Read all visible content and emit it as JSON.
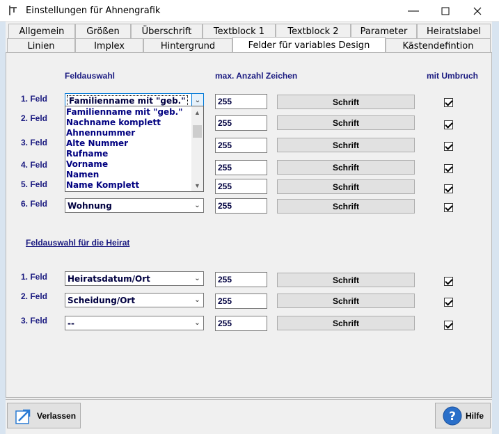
{
  "window": {
    "title": "Einstellungen für Ahnengrafik"
  },
  "tabs_row1": [
    "Allgemein",
    "Größen",
    "Überschrift",
    "Textblock 1",
    "Textblock 2",
    "Parameter",
    "Heiratslabel"
  ],
  "tabs_row2": [
    "Linien",
    "Implex",
    "Hintergrund",
    "Felder für variables Design",
    "Kästendefintion"
  ],
  "active_tab": "Felder für variables Design",
  "headers": {
    "feldauswahl": "Feldauswahl",
    "max_chars": "max. Anzahl Zeichen",
    "umbruch": "mit Umbruch"
  },
  "fields": [
    {
      "label": "1. Feld",
      "value": "Familienname mit \"geb.\"",
      "max": "255",
      "font": "Schrift",
      "wrap": true
    },
    {
      "label": "2. Feld",
      "value": "",
      "max": "255",
      "font": "Schrift",
      "wrap": true
    },
    {
      "label": "3. Feld",
      "value": "",
      "max": "255",
      "font": "Schrift",
      "wrap": true
    },
    {
      "label": "4. Feld",
      "value": "",
      "max": "255",
      "font": "Schrift",
      "wrap": true
    },
    {
      "label": "5. Feld",
      "value": "",
      "max": "255",
      "font": "Schrift",
      "wrap": true
    },
    {
      "label": "6. Feld",
      "value": "Wohnung",
      "max": "255",
      "font": "Schrift",
      "wrap": true
    }
  ],
  "dropdown_options": [
    "Familienname mit \"geb.\"",
    "Nachname komplett",
    "Ahnennummer",
    "Alte Nummer",
    "Rufname",
    "Vorname",
    "Namen",
    "Name Komplett"
  ],
  "marriage_section": {
    "title": "Feldauswahl für die Heirat",
    "fields": [
      {
        "label": "1. Feld",
        "value": "Heiratsdatum/Ort",
        "max": "255",
        "font": "Schrift",
        "wrap": true
      },
      {
        "label": "2. Feld",
        "value": "Scheidung/Ort",
        "max": "255",
        "font": "Schrift",
        "wrap": true
      },
      {
        "label": "3. Feld",
        "value": "--",
        "max": "255",
        "font": "Schrift",
        "wrap": true
      }
    ]
  },
  "buttons": {
    "exit": "Verlassen",
    "help": "Hilfe"
  }
}
